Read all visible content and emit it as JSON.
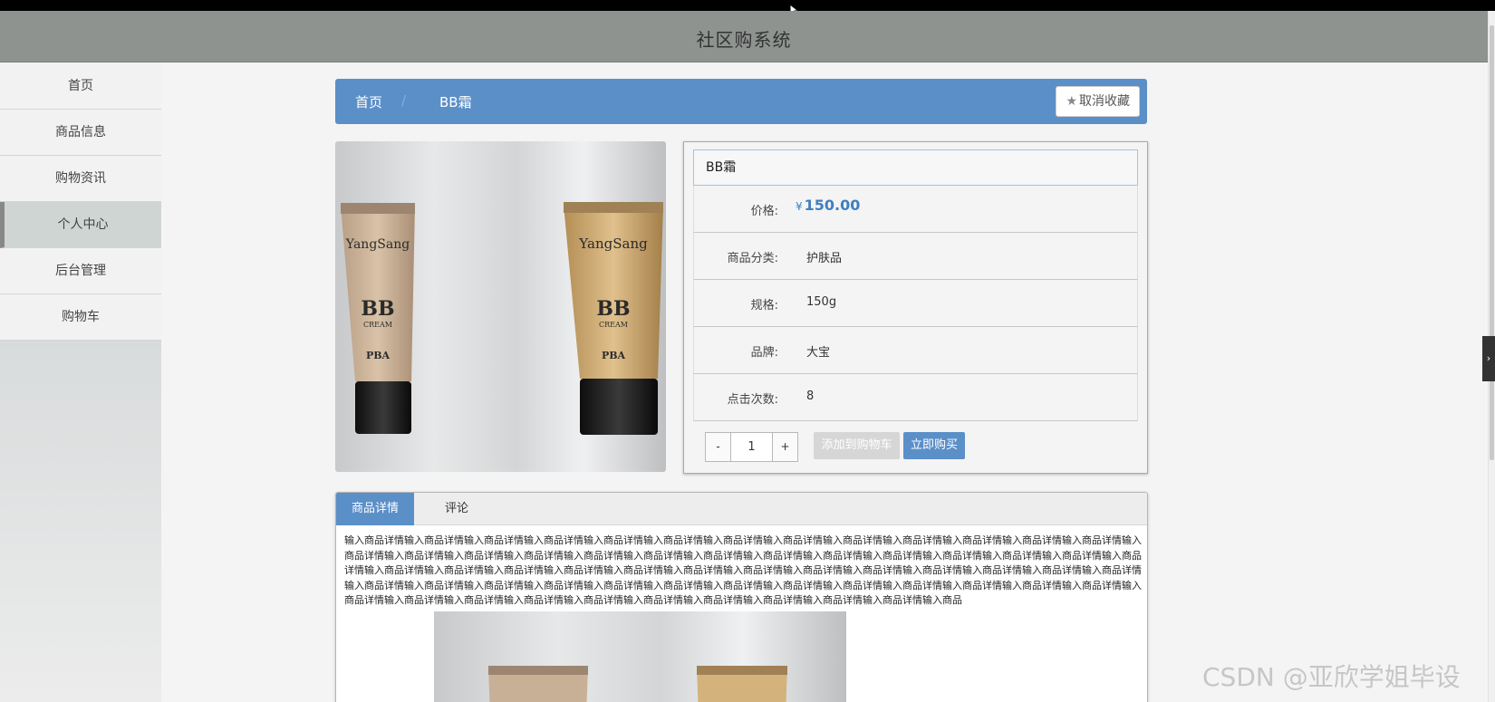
{
  "header": {
    "title": "社区购系统"
  },
  "sidebar": {
    "items": [
      {
        "label": "首页"
      },
      {
        "label": "商品信息"
      },
      {
        "label": "购物资讯"
      },
      {
        "label": "个人中心"
      },
      {
        "label": "后台管理"
      },
      {
        "label": "购物车"
      }
    ],
    "active_index": 3
  },
  "breadcrumb": {
    "home": "首页",
    "separator": "/",
    "current": "BB霜"
  },
  "favorite_button": {
    "label": "取消收藏",
    "icon": "star-icon"
  },
  "product": {
    "name": "BB霜",
    "image_text": {
      "brand": "YangSang",
      "product_line": "BB",
      "cream": "CREAM",
      "sub": "PBA"
    },
    "price_label": "价格:",
    "price_currency": "¥",
    "price": "150.00",
    "category_label": "商品分类:",
    "category": "护肤品",
    "spec_label": "规格:",
    "spec": "150g",
    "brand_label": "品牌:",
    "brand": "大宝",
    "clicks_label": "点击次数:",
    "clicks": "8"
  },
  "cart_controls": {
    "minus": "-",
    "quantity": "1",
    "plus": "+",
    "add_to_cart": "添加到购物车",
    "buy_now": "立即购买"
  },
  "tabs": {
    "details": "商品详情",
    "comments": "评论"
  },
  "details_text": "输入商品详情输入商品详情输入商品详情输入商品详情输入商品详情输入商品详情输入商品详情输入商品详情输入商品详情输入商品详情输入商品详情输入商品详情输入商品详情输入商品详情输入商品详情输入商品详情输入商品详情输入商品详情输入商品详情输入商品详情输入商品详情输入商品详情输入商品详情输入商品详情输入商品详情输入商品详情输入商品详情输入商品详情输入商品详情输入商品详情输入商品详情输入商品详情输入商品详情输入商品详情输入商品详情输入商品详情输入商品详情输入商品详情输入商品详情输入商品详情输入商品详情输入商品详情输入商品详情输入商品详情输入商品详情输入商品详情输入商品详情输入商品详情输入商品详情输入商品详情输入商品详情输入商品详情输入商品详情输入商品详情输入商品详情输入商品详情输入商品详情输入商品详情输入商品详情输入商品详情输入商品详情输入商品详情输入商品详情输入商品",
  "watermark": "CSDN @亚欣学姐毕设",
  "colors": {
    "accent": "#5b8fc8",
    "header_bg": "#8e9390",
    "price": "#3f7fc2"
  }
}
